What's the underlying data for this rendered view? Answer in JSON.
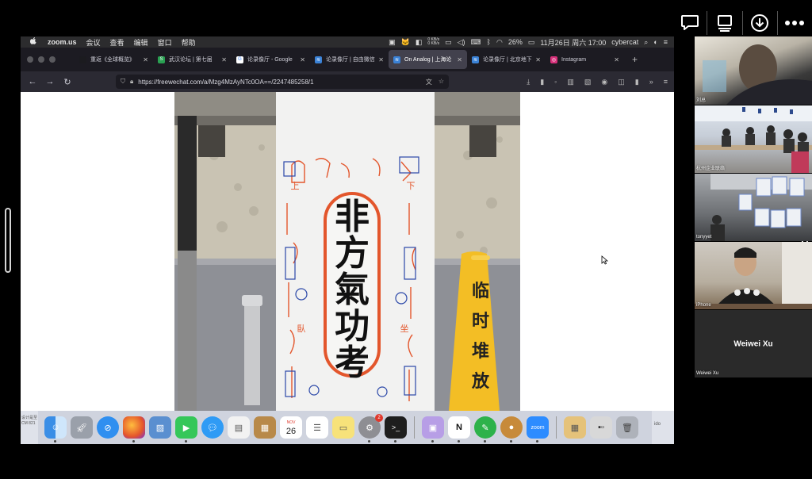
{
  "zoom_controls": {
    "chat_icon": "chat-bubble-icon",
    "share_icon": "share-screen-icon",
    "download_icon": "download-circle-icon",
    "more_icon": "more-dots-icon"
  },
  "menubar": {
    "apple": "",
    "app": "zoom.us",
    "items": [
      "会议",
      "查看",
      "编辑",
      "窗口",
      "帮助"
    ],
    "net_up": "0 KB/s",
    "net_down": "0 KB/s",
    "battery": "26%",
    "datetime": "11月26日 周六  17:00",
    "user": "cybercat"
  },
  "browser": {
    "tabs": [
      {
        "label": "重返《全球概览》",
        "favicon_color": "#1b1b1f",
        "favicon": ""
      },
      {
        "label": "武汉论坛 | 第七届",
        "favicon_color": "#2aa052",
        "favicon": "S"
      },
      {
        "label": "论录像厅 - Google",
        "favicon_color": "#ffffff",
        "favicon": "G"
      },
      {
        "label": "论录像厅 | 自由微信",
        "favicon_color": "#3b82d6",
        "favicon": "≋"
      },
      {
        "label": "On Analog | 上海论",
        "favicon_color": "#3b82d6",
        "favicon": "≋",
        "active": true
      },
      {
        "label": "论录像厅 | 北京地下",
        "favicon_color": "#3b82d6",
        "favicon": "≋"
      },
      {
        "label": "Instagram",
        "favicon_color": "#d6307a",
        "favicon": "◎"
      }
    ],
    "url": "https://freewechat.com/a/Mzg4MzAyNTc0OA==/2247485258/1"
  },
  "photo": {
    "banner_text": "非方氣功考",
    "banner_small_labels": [
      "上",
      "下",
      "臥",
      "坐"
    ],
    "cone_text": [
      "临",
      "时",
      "堆",
      "放"
    ]
  },
  "dock": {
    "left_label_1": "设计是至",
    "left_label_2": "CM 821",
    "right_label": "ido",
    "calendar_day": "26",
    "calendar_month": "NOV",
    "settings_badge": "2",
    "zoom_label": "zoom",
    "apps": [
      "finder",
      "launchpad",
      "safari",
      "firefox",
      "preview",
      "facetime",
      "messages",
      "textedit",
      "notes-brown",
      "calendar",
      "reminders",
      "stickies",
      "system-preferences",
      "terminal"
    ]
  },
  "participants": [
    {
      "name": "刘总"
    },
    {
      "name": "杭州企业联络"
    },
    {
      "name": "tonyyet"
    },
    {
      "name": "iPhone"
    },
    {
      "name": "Weiwei Xu",
      "display": "Weiwei Xu"
    }
  ]
}
